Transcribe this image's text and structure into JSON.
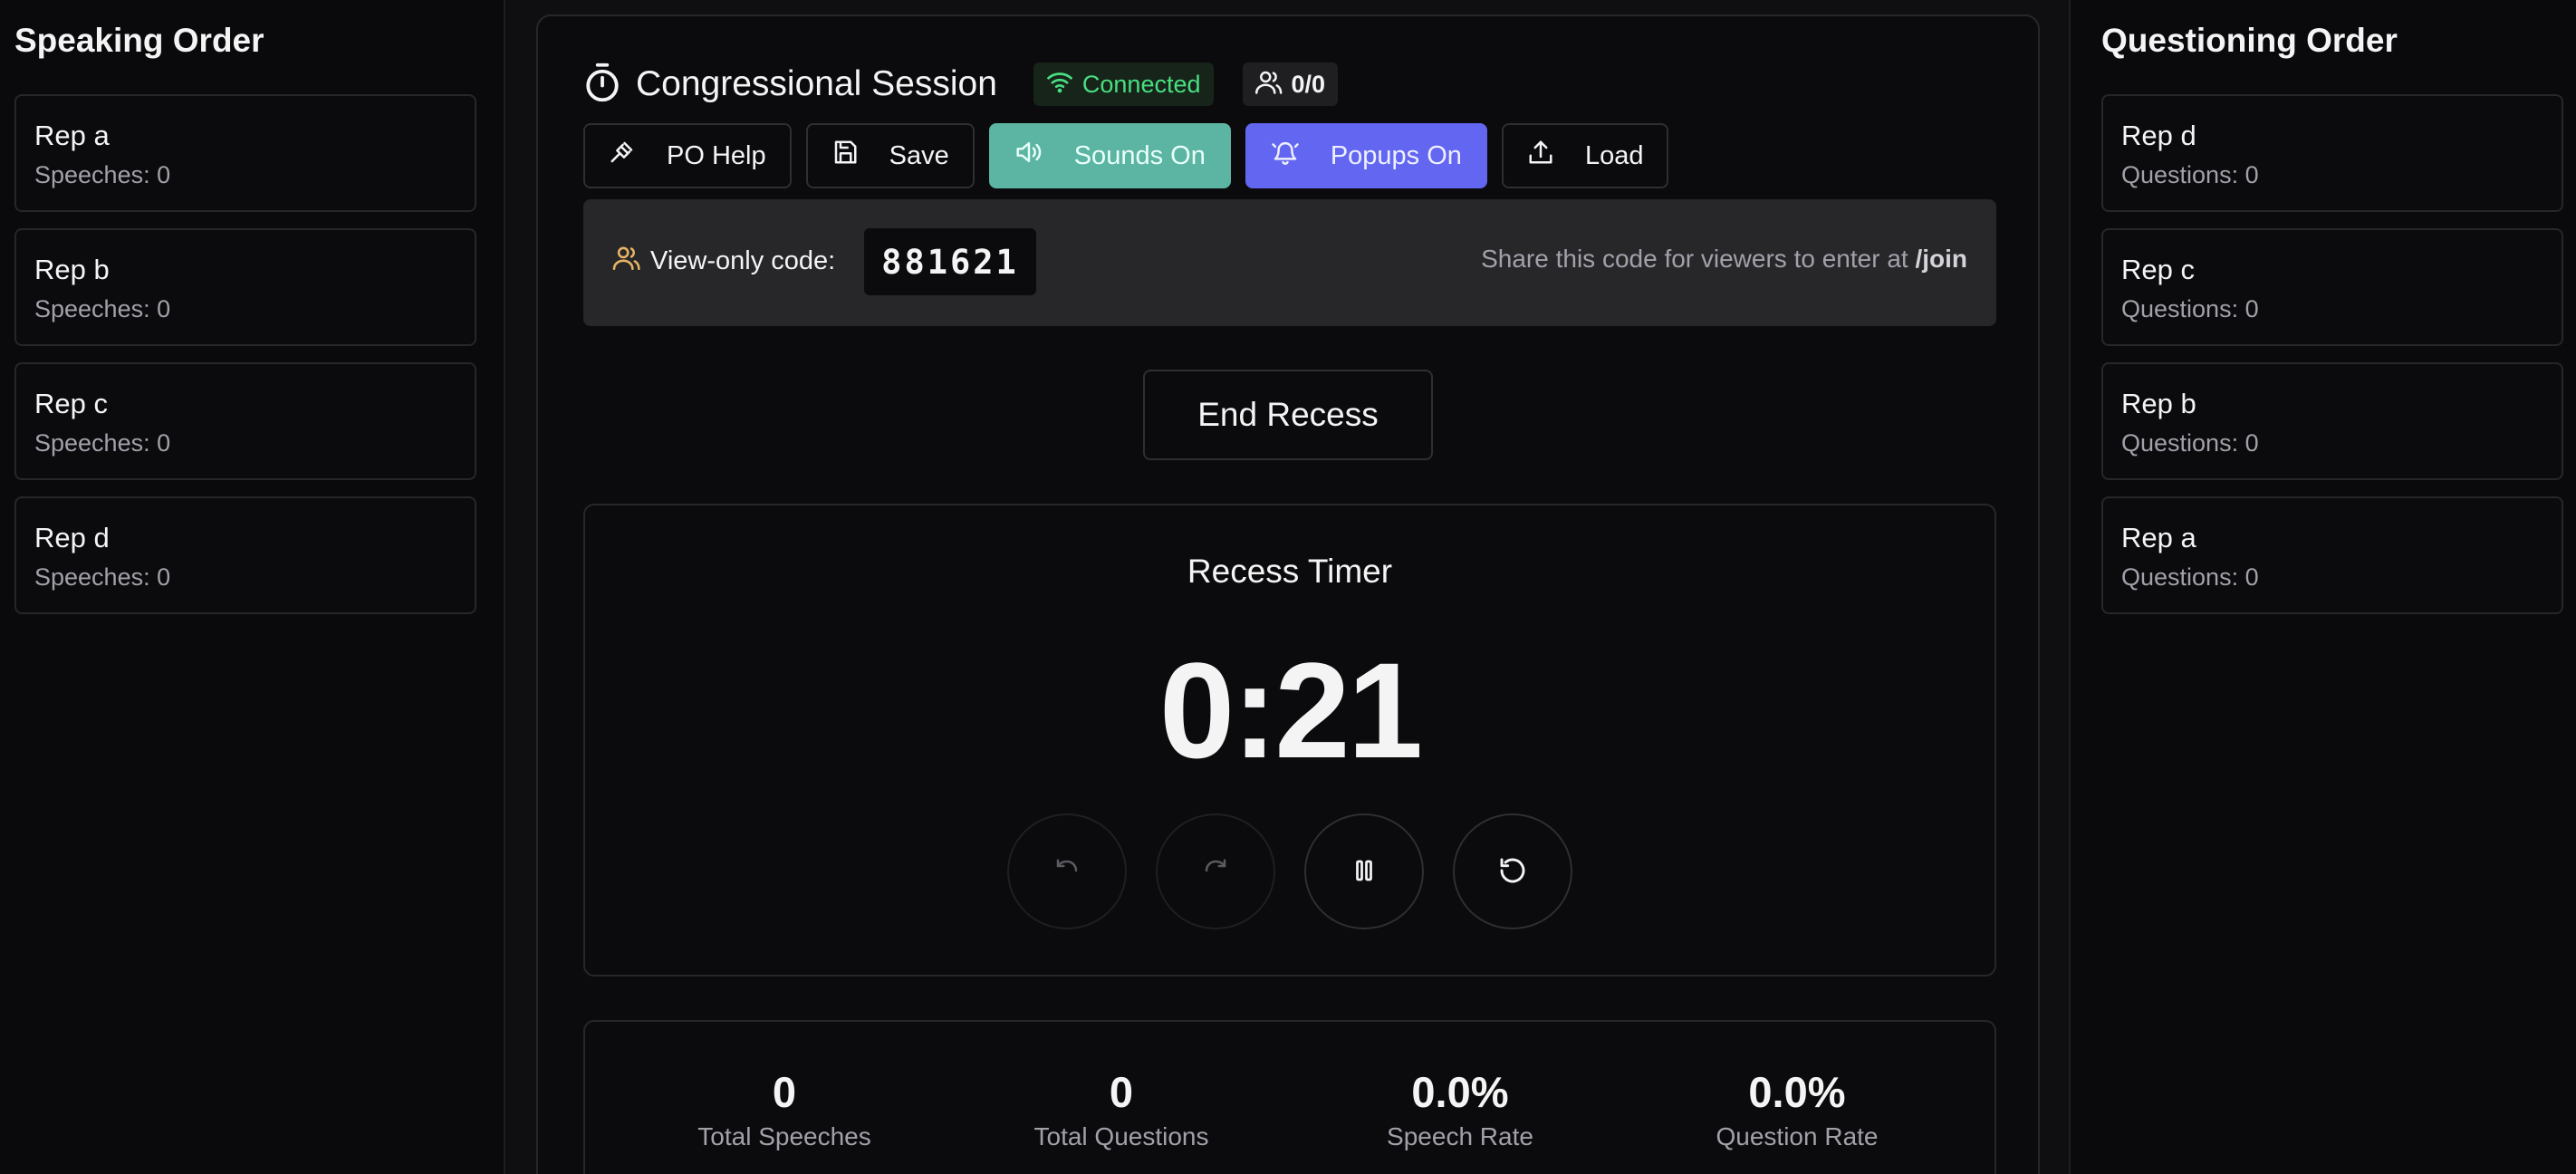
{
  "speaking": {
    "title": "Speaking Order",
    "reps": [
      {
        "name": "Rep a",
        "sub": "Speeches: 0"
      },
      {
        "name": "Rep b",
        "sub": "Speeches: 0"
      },
      {
        "name": "Rep c",
        "sub": "Speeches: 0"
      },
      {
        "name": "Rep d",
        "sub": "Speeches: 0"
      }
    ]
  },
  "questioning": {
    "title": "Questioning Order",
    "reps": [
      {
        "name": "Rep d",
        "sub": "Questions: 0"
      },
      {
        "name": "Rep c",
        "sub": "Questions: 0"
      },
      {
        "name": "Rep b",
        "sub": "Questions: 0"
      },
      {
        "name": "Rep a",
        "sub": "Questions: 0"
      }
    ]
  },
  "header": {
    "title": "Congressional Session",
    "status": "Connected",
    "viewers": "0/0"
  },
  "toolbar": {
    "po_help": "PO Help",
    "save": "Save",
    "sounds": "Sounds On",
    "popups": "Popups On",
    "load": "Load"
  },
  "code": {
    "label": "View-only code:",
    "value": "881621",
    "share_text": "Share this code for viewers to enter at ",
    "share_path": "/join"
  },
  "end_recess": "End Recess",
  "timer": {
    "title": "Recess Timer",
    "value": "0:21"
  },
  "stats": [
    {
      "value": "0",
      "label": "Total Speeches"
    },
    {
      "value": "0",
      "label": "Total Questions"
    },
    {
      "value": "0.0%",
      "label": "Speech Rate"
    },
    {
      "value": "0.0%",
      "label": "Question Rate"
    }
  ],
  "colors": {
    "background": "#0b0b0d",
    "connected": "#4ade80",
    "sounds": "#5bb5a2",
    "popups": "#6366f1",
    "code_panel": "#27272a"
  },
  "icons": {
    "timer": "stopwatch-icon",
    "connected": "wifi-icon",
    "viewers": "users-icon",
    "po_help": "gavel-icon",
    "save": "save-icon",
    "sounds": "volume-icon",
    "popups": "bell-icon",
    "load": "upload-icon"
  }
}
